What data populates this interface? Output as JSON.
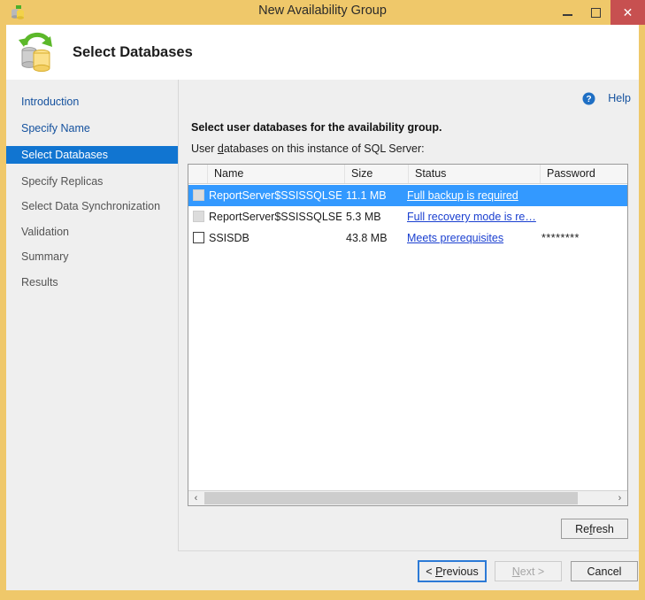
{
  "window": {
    "title": "New Availability Group",
    "app_icon": "database-icon",
    "controls": {
      "minimize": "minimize-icon",
      "maximize": "maximize-icon",
      "close": "✕"
    },
    "frame_color": "#efc86a"
  },
  "header": {
    "title": "Select Databases",
    "icon": "databases-sync-icon"
  },
  "sidebar": {
    "items": [
      {
        "label": "Introduction",
        "state": "link"
      },
      {
        "label": "Specify Name",
        "state": "link"
      },
      {
        "label": "Select Databases",
        "state": "active"
      },
      {
        "label": "Specify Replicas",
        "state": "normal"
      },
      {
        "label": "Select Data Synchronization",
        "state": "normal"
      },
      {
        "label": "Validation",
        "state": "normal"
      },
      {
        "label": "Summary",
        "state": "normal"
      },
      {
        "label": "Results",
        "state": "normal"
      }
    ],
    "active_color": "#1175d1",
    "link_color": "#14519e"
  },
  "help": {
    "label": "Help",
    "icon": "help-circle-icon"
  },
  "instructions": {
    "main": "Select user databases for the availability group.",
    "sub_before": "User ",
    "sub_accel": "d",
    "sub_after": "atabases on this instance of SQL Server:"
  },
  "table": {
    "columns": [
      "",
      "Name",
      "Size",
      "Status",
      "Password"
    ],
    "rows": [
      {
        "checkbox": "disabled",
        "checked": false,
        "name": "ReportServer$SSISSQLSER…",
        "size": "11.1 MB",
        "status": "Full backup is required",
        "password": "",
        "selected": true
      },
      {
        "checkbox": "disabled",
        "checked": false,
        "name": "ReportServer$SSISSQLSER…",
        "size": "5.3 MB",
        "status": "Full recovery mode is re…",
        "password": "",
        "selected": false
      },
      {
        "checkbox": "enabled",
        "checked": false,
        "name": "SSISDB",
        "size": "43.8 MB",
        "status": "Meets prerequisites",
        "password": "********",
        "selected": false
      }
    ],
    "selection_color": "#3399ff",
    "link_color": "#1a3fd0"
  },
  "scrollbar": {
    "left_arrow": "‹",
    "right_arrow": "›"
  },
  "buttons": {
    "refresh_before": "Re",
    "refresh_accel": "f",
    "refresh_after": "resh",
    "previous_before": "< ",
    "previous_accel": "P",
    "previous_after": "revious",
    "next_accel": "N",
    "next_after": "ext >",
    "cancel": "Cancel"
  }
}
